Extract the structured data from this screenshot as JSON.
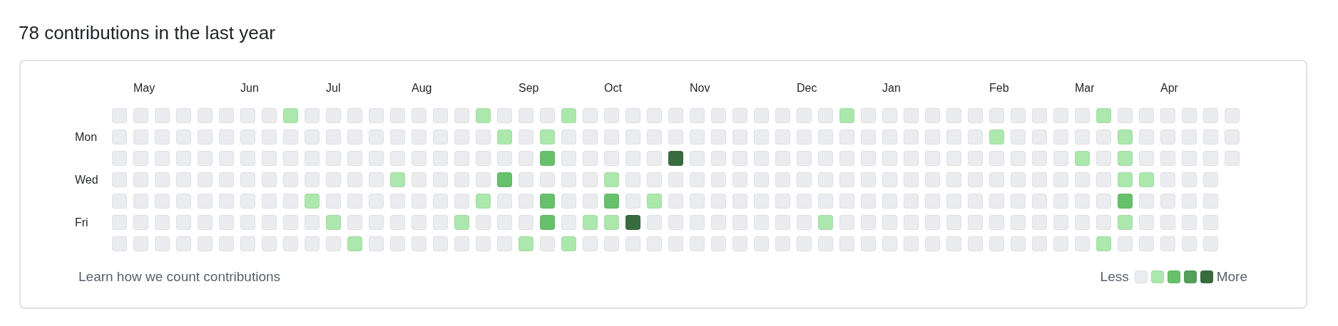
{
  "title": "78 contributions in the last year",
  "day_labels": [
    "Mon",
    "Wed",
    "Fri"
  ],
  "weeks": [
    {
      "days": [
        {
          "color": "#ebecf0"
        },
        {
          "color": "#ebecf0"
        },
        {
          "color": "#ebecf0"
        },
        {
          "color": "#ebecf0"
        },
        {
          "color": "#ebecf0"
        },
        {
          "color": "#ebecf0"
        },
        {
          "color": "#ebecf0"
        }
      ]
    },
    {
      "month": "May",
      "days": [
        {
          "color": "#ebecf0"
        },
        {
          "color": "#ebecf0"
        },
        {
          "color": "#ebecf0"
        },
        {
          "color": "#ebecf0"
        },
        {
          "color": "#ebecf0"
        },
        {
          "color": "#ebecf0"
        },
        {
          "color": "#ebecf0"
        }
      ]
    },
    {
      "days": [
        {
          "color": "#ebecf0"
        },
        {
          "color": "#ebecf0"
        },
        {
          "color": "#ebecf0"
        },
        {
          "color": "#ebecf0"
        },
        {
          "color": "#ebecf0"
        },
        {
          "color": "#ebecf0"
        },
        {
          "color": "#ebecf0"
        }
      ]
    },
    {
      "days": [
        {
          "color": "#ebecf0"
        },
        {
          "color": "#ebecf0"
        },
        {
          "color": "#ebecf0"
        },
        {
          "color": "#ebecf0"
        },
        {
          "color": "#ebecf0"
        },
        {
          "color": "#ebecf0"
        },
        {
          "color": "#ebecf0"
        }
      ]
    },
    {
      "days": [
        {
          "color": "#ebecf0"
        },
        {
          "color": "#ebecf0"
        },
        {
          "color": "#ebecf0"
        },
        {
          "color": "#ebecf0"
        },
        {
          "color": "#ebecf0"
        },
        {
          "color": "#ebecf0"
        },
        {
          "color": "#ebecf0"
        }
      ]
    },
    {
      "days": [
        {
          "color": "#ebecf0"
        },
        {
          "color": "#ebecf0"
        },
        {
          "color": "#ebecf0"
        },
        {
          "color": "#ebecf0"
        },
        {
          "color": "#ebecf0"
        },
        {
          "color": "#ebecf0"
        },
        {
          "color": "#ebecf0"
        }
      ]
    },
    {
      "month": "Jun",
      "days": [
        {
          "color": "#ebecf0"
        },
        {
          "color": "#ebecf0"
        },
        {
          "color": "#ebecf0"
        },
        {
          "color": "#ebecf0"
        },
        {
          "color": "#ebecf0"
        },
        {
          "color": "#ebecf0"
        },
        {
          "color": "#ebecf0"
        }
      ]
    },
    {
      "days": [
        {
          "color": "#ebecf0"
        },
        {
          "color": "#ebecf0"
        },
        {
          "color": "#ebecf0"
        },
        {
          "color": "#ebecf0"
        },
        {
          "color": "#ebecf0"
        },
        {
          "color": "#ebecf0"
        },
        {
          "color": "#ebecf0"
        }
      ]
    },
    {
      "days": [
        {
          "color": "#ace7ae"
        },
        {
          "color": "#ebecf0"
        },
        {
          "color": "#ebecf0"
        },
        {
          "color": "#ebecf0"
        },
        {
          "color": "#ebecf0"
        },
        {
          "color": "#ebecf0"
        },
        {
          "color": "#ebecf0"
        }
      ]
    },
    {
      "days": [
        {
          "color": "#ebecf0"
        },
        {
          "color": "#ebecf0"
        },
        {
          "color": "#ebecf0"
        },
        {
          "color": "#ebecf0"
        },
        {
          "color": "#ace7ae"
        },
        {
          "color": "#ebecf0"
        },
        {
          "color": "#ebecf0"
        }
      ]
    },
    {
      "month": "Jul",
      "days": [
        {
          "color": "#ebecf0"
        },
        {
          "color": "#ebecf0"
        },
        {
          "color": "#ebecf0"
        },
        {
          "color": "#ebecf0"
        },
        {
          "color": "#ebecf0"
        },
        {
          "color": "#ace7ae"
        },
        {
          "color": "#ebecf0"
        }
      ]
    },
    {
      "days": [
        {
          "color": "#ebecf0"
        },
        {
          "color": "#ebecf0"
        },
        {
          "color": "#ebecf0"
        },
        {
          "color": "#ebecf0"
        },
        {
          "color": "#ebecf0"
        },
        {
          "color": "#ebecf0"
        },
        {
          "color": "#ace7ae"
        }
      ]
    },
    {
      "days": [
        {
          "color": "#ebecf0"
        },
        {
          "color": "#ebecf0"
        },
        {
          "color": "#ebecf0"
        },
        {
          "color": "#ebecf0"
        },
        {
          "color": "#ebecf0"
        },
        {
          "color": "#ebecf0"
        },
        {
          "color": "#ebecf0"
        }
      ]
    },
    {
      "days": [
        {
          "color": "#ebecf0"
        },
        {
          "color": "#ebecf0"
        },
        {
          "color": "#ebecf0"
        },
        {
          "color": "#ace7ae"
        },
        {
          "color": "#ebecf0"
        },
        {
          "color": "#ebecf0"
        },
        {
          "color": "#ebecf0"
        }
      ]
    },
    {
      "month": "Aug",
      "days": [
        {
          "color": "#ebecf0"
        },
        {
          "color": "#ebecf0"
        },
        {
          "color": "#ebecf0"
        },
        {
          "color": "#ebecf0"
        },
        {
          "color": "#ebecf0"
        },
        {
          "color": "#ebecf0"
        },
        {
          "color": "#ebecf0"
        }
      ]
    },
    {
      "days": [
        {
          "color": "#ebecf0"
        },
        {
          "color": "#ebecf0"
        },
        {
          "color": "#ebecf0"
        },
        {
          "color": "#ebecf0"
        },
        {
          "color": "#ebecf0"
        },
        {
          "color": "#ebecf0"
        },
        {
          "color": "#ebecf0"
        }
      ]
    },
    {
      "days": [
        {
          "color": "#ebecf0"
        },
        {
          "color": "#ebecf0"
        },
        {
          "color": "#ebecf0"
        },
        {
          "color": "#ebecf0"
        },
        {
          "color": "#ebecf0"
        },
        {
          "color": "#ace7ae"
        },
        {
          "color": "#ebecf0"
        }
      ]
    },
    {
      "days": [
        {
          "color": "#ace7ae"
        },
        {
          "color": "#ebecf0"
        },
        {
          "color": "#ebecf0"
        },
        {
          "color": "#ebecf0"
        },
        {
          "color": "#ace7ae"
        },
        {
          "color": "#ebecf0"
        },
        {
          "color": "#ebecf0"
        }
      ]
    },
    {
      "days": [
        {
          "color": "#ebecf0"
        },
        {
          "color": "#ace7ae"
        },
        {
          "color": "#ebecf0"
        },
        {
          "color": "#66c06c"
        },
        {
          "color": "#ebecf0"
        },
        {
          "color": "#ebecf0"
        },
        {
          "color": "#ebecf0"
        }
      ]
    },
    {
      "month": "Sep",
      "days": [
        {
          "color": "#ebecf0"
        },
        {
          "color": "#ebecf0"
        },
        {
          "color": "#ebecf0"
        },
        {
          "color": "#ebecf0"
        },
        {
          "color": "#ebecf0"
        },
        {
          "color": "#ebecf0"
        },
        {
          "color": "#ace7ae"
        }
      ]
    },
    {
      "days": [
        {
          "color": "#ebecf0"
        },
        {
          "color": "#ace7ae"
        },
        {
          "color": "#66c06c"
        },
        {
          "color": "#ebecf0"
        },
        {
          "color": "#66c06c"
        },
        {
          "color": "#66c06c"
        },
        {
          "color": "#ebecf0"
        }
      ]
    },
    {
      "days": [
        {
          "color": "#ace7ae"
        },
        {
          "color": "#ebecf0"
        },
        {
          "color": "#ebecf0"
        },
        {
          "color": "#ebecf0"
        },
        {
          "color": "#ebecf0"
        },
        {
          "color": "#ebecf0"
        },
        {
          "color": "#ace7ae"
        }
      ]
    },
    {
      "days": [
        {
          "color": "#ebecf0"
        },
        {
          "color": "#ebecf0"
        },
        {
          "color": "#ebecf0"
        },
        {
          "color": "#ebecf0"
        },
        {
          "color": "#ebecf0"
        },
        {
          "color": "#ace7ae"
        },
        {
          "color": "#ebecf0"
        }
      ]
    },
    {
      "month": "Oct",
      "days": [
        {
          "color": "#ebecf0"
        },
        {
          "color": "#ebecf0"
        },
        {
          "color": "#ebecf0"
        },
        {
          "color": "#ace7ae"
        },
        {
          "color": "#66c06c"
        },
        {
          "color": "#ace7ae"
        },
        {
          "color": "#ebecf0"
        }
      ]
    },
    {
      "days": [
        {
          "color": "#ebecf0"
        },
        {
          "color": "#ebecf0"
        },
        {
          "color": "#ebecf0"
        },
        {
          "color": "#ebecf0"
        },
        {
          "color": "#ebecf0"
        },
        {
          "color": "#386c3e"
        },
        {
          "color": "#ebecf0"
        }
      ]
    },
    {
      "days": [
        {
          "color": "#ebecf0"
        },
        {
          "color": "#ebecf0"
        },
        {
          "color": "#ebecf0"
        },
        {
          "color": "#ebecf0"
        },
        {
          "color": "#ace7ae"
        },
        {
          "color": "#ebecf0"
        },
        {
          "color": "#ebecf0"
        }
      ]
    },
    {
      "days": [
        {
          "color": "#ebecf0"
        },
        {
          "color": "#ebecf0"
        },
        {
          "color": "#386c3e"
        },
        {
          "color": "#ebecf0"
        },
        {
          "color": "#ebecf0"
        },
        {
          "color": "#ebecf0"
        },
        {
          "color": "#ebecf0"
        }
      ]
    },
    {
      "month": "Nov",
      "days": [
        {
          "color": "#ebecf0"
        },
        {
          "color": "#ebecf0"
        },
        {
          "color": "#ebecf0"
        },
        {
          "color": "#ebecf0"
        },
        {
          "color": "#ebecf0"
        },
        {
          "color": "#ebecf0"
        },
        {
          "color": "#ebecf0"
        }
      ]
    },
    {
      "days": [
        {
          "color": "#ebecf0"
        },
        {
          "color": "#ebecf0"
        },
        {
          "color": "#ebecf0"
        },
        {
          "color": "#ebecf0"
        },
        {
          "color": "#ebecf0"
        },
        {
          "color": "#ebecf0"
        },
        {
          "color": "#ebecf0"
        }
      ]
    },
    {
      "days": [
        {
          "color": "#ebecf0"
        },
        {
          "color": "#ebecf0"
        },
        {
          "color": "#ebecf0"
        },
        {
          "color": "#ebecf0"
        },
        {
          "color": "#ebecf0"
        },
        {
          "color": "#ebecf0"
        },
        {
          "color": "#ebecf0"
        }
      ]
    },
    {
      "days": [
        {
          "color": "#ebecf0"
        },
        {
          "color": "#ebecf0"
        },
        {
          "color": "#ebecf0"
        },
        {
          "color": "#ebecf0"
        },
        {
          "color": "#ebecf0"
        },
        {
          "color": "#ebecf0"
        },
        {
          "color": "#ebecf0"
        }
      ]
    },
    {
      "days": [
        {
          "color": "#ebecf0"
        },
        {
          "color": "#ebecf0"
        },
        {
          "color": "#ebecf0"
        },
        {
          "color": "#ebecf0"
        },
        {
          "color": "#ebecf0"
        },
        {
          "color": "#ebecf0"
        },
        {
          "color": "#ebecf0"
        }
      ]
    },
    {
      "month": "Dec",
      "days": [
        {
          "color": "#ebecf0"
        },
        {
          "color": "#ebecf0"
        },
        {
          "color": "#ebecf0"
        },
        {
          "color": "#ebecf0"
        },
        {
          "color": "#ebecf0"
        },
        {
          "color": "#ebecf0"
        },
        {
          "color": "#ebecf0"
        }
      ]
    },
    {
      "days": [
        {
          "color": "#ebecf0"
        },
        {
          "color": "#ebecf0"
        },
        {
          "color": "#ebecf0"
        },
        {
          "color": "#ebecf0"
        },
        {
          "color": "#ebecf0"
        },
        {
          "color": "#ace7ae"
        },
        {
          "color": "#ebecf0"
        }
      ]
    },
    {
      "days": [
        {
          "color": "#ace7ae"
        },
        {
          "color": "#ebecf0"
        },
        {
          "color": "#ebecf0"
        },
        {
          "color": "#ebecf0"
        },
        {
          "color": "#ebecf0"
        },
        {
          "color": "#ebecf0"
        },
        {
          "color": "#ebecf0"
        }
      ]
    },
    {
      "days": [
        {
          "color": "#ebecf0"
        },
        {
          "color": "#ebecf0"
        },
        {
          "color": "#ebecf0"
        },
        {
          "color": "#ebecf0"
        },
        {
          "color": "#ebecf0"
        },
        {
          "color": "#ebecf0"
        },
        {
          "color": "#ebecf0"
        }
      ]
    },
    {
      "month": "Jan",
      "days": [
        {
          "color": "#ebecf0"
        },
        {
          "color": "#ebecf0"
        },
        {
          "color": "#ebecf0"
        },
        {
          "color": "#ebecf0"
        },
        {
          "color": "#ebecf0"
        },
        {
          "color": "#ebecf0"
        },
        {
          "color": "#ebecf0"
        }
      ]
    },
    {
      "days": [
        {
          "color": "#ebecf0"
        },
        {
          "color": "#ebecf0"
        },
        {
          "color": "#ebecf0"
        },
        {
          "color": "#ebecf0"
        },
        {
          "color": "#ebecf0"
        },
        {
          "color": "#ebecf0"
        },
        {
          "color": "#ebecf0"
        }
      ]
    },
    {
      "days": [
        {
          "color": "#ebecf0"
        },
        {
          "color": "#ebecf0"
        },
        {
          "color": "#ebecf0"
        },
        {
          "color": "#ebecf0"
        },
        {
          "color": "#ebecf0"
        },
        {
          "color": "#ebecf0"
        },
        {
          "color": "#ebecf0"
        }
      ]
    },
    {
      "days": [
        {
          "color": "#ebecf0"
        },
        {
          "color": "#ebecf0"
        },
        {
          "color": "#ebecf0"
        },
        {
          "color": "#ebecf0"
        },
        {
          "color": "#ebecf0"
        },
        {
          "color": "#ebecf0"
        },
        {
          "color": "#ebecf0"
        }
      ]
    },
    {
      "days": [
        {
          "color": "#ebecf0"
        },
        {
          "color": "#ebecf0"
        },
        {
          "color": "#ebecf0"
        },
        {
          "color": "#ebecf0"
        },
        {
          "color": "#ebecf0"
        },
        {
          "color": "#ebecf0"
        },
        {
          "color": "#ebecf0"
        }
      ]
    },
    {
      "month": "Feb",
      "days": [
        {
          "color": "#ebecf0"
        },
        {
          "color": "#ace7ae"
        },
        {
          "color": "#ebecf0"
        },
        {
          "color": "#ebecf0"
        },
        {
          "color": "#ebecf0"
        },
        {
          "color": "#ebecf0"
        },
        {
          "color": "#ebecf0"
        }
      ]
    },
    {
      "days": [
        {
          "color": "#ebecf0"
        },
        {
          "color": "#ebecf0"
        },
        {
          "color": "#ebecf0"
        },
        {
          "color": "#ebecf0"
        },
        {
          "color": "#ebecf0"
        },
        {
          "color": "#ebecf0"
        },
        {
          "color": "#ebecf0"
        }
      ]
    },
    {
      "days": [
        {
          "color": "#ebecf0"
        },
        {
          "color": "#ebecf0"
        },
        {
          "color": "#ebecf0"
        },
        {
          "color": "#ebecf0"
        },
        {
          "color": "#ebecf0"
        },
        {
          "color": "#ebecf0"
        },
        {
          "color": "#ebecf0"
        }
      ]
    },
    {
      "days": [
        {
          "color": "#ebecf0"
        },
        {
          "color": "#ebecf0"
        },
        {
          "color": "#ebecf0"
        },
        {
          "color": "#ebecf0"
        },
        {
          "color": "#ebecf0"
        },
        {
          "color": "#ebecf0"
        },
        {
          "color": "#ebecf0"
        }
      ]
    },
    {
      "month": "Mar",
      "days": [
        {
          "color": "#ebecf0"
        },
        {
          "color": "#ebecf0"
        },
        {
          "color": "#ace7ae"
        },
        {
          "color": "#ebecf0"
        },
        {
          "color": "#ebecf0"
        },
        {
          "color": "#ebecf0"
        },
        {
          "color": "#ebecf0"
        }
      ]
    },
    {
      "days": [
        {
          "color": "#ace7ae"
        },
        {
          "color": "#ebecf0"
        },
        {
          "color": "#ebecf0"
        },
        {
          "color": "#ebecf0"
        },
        {
          "color": "#ebecf0"
        },
        {
          "color": "#ebecf0"
        },
        {
          "color": "#ace7ae"
        }
      ]
    },
    {
      "days": [
        {
          "color": "#ebecf0"
        },
        {
          "color": "#ace7ae"
        },
        {
          "color": "#ace7ae"
        },
        {
          "color": "#ace7ae"
        },
        {
          "color": "#66c06c"
        },
        {
          "color": "#ace7ae"
        },
        {
          "color": "#ebecf0"
        }
      ]
    },
    {
      "days": [
        {
          "color": "#ebecf0"
        },
        {
          "color": "#ebecf0"
        },
        {
          "color": "#ebecf0"
        },
        {
          "color": "#ace7ae"
        },
        {
          "color": "#ebecf0"
        },
        {
          "color": "#ebecf0"
        },
        {
          "color": "#ebecf0"
        }
      ]
    },
    {
      "month": "Apr",
      "days": [
        {
          "color": "#ebecf0"
        },
        {
          "color": "#ebecf0"
        },
        {
          "color": "#ebecf0"
        },
        {
          "color": "#ebecf0"
        },
        {
          "color": "#ebecf0"
        },
        {
          "color": "#ebecf0"
        },
        {
          "color": "#ebecf0"
        }
      ]
    },
    {
      "days": [
        {
          "color": "#ebecf0"
        },
        {
          "color": "#ebecf0"
        },
        {
          "color": "#ebecf0"
        },
        {
          "color": "#ebecf0"
        },
        {
          "color": "#ebecf0"
        },
        {
          "color": "#ebecf0"
        },
        {
          "color": "#ebecf0"
        }
      ]
    },
    {
      "days": [
        {
          "color": "#ebecf0"
        },
        {
          "color": "#ebecf0"
        },
        {
          "color": "#ebecf0"
        },
        {
          "color": "#ebecf0"
        },
        {
          "color": "#ebecf0"
        },
        {
          "color": "#ebecf0"
        },
        {
          "color": "#ebecf0"
        }
      ]
    },
    {
      "days": [
        {
          "color": "#ebecf0"
        },
        {
          "color": "#ebecf0"
        },
        {
          "color": "#ebecf0"
        }
      ]
    }
  ],
  "footer_link": "Learn how we count contributions",
  "legend": {
    "less": "Less",
    "more": "More",
    "swatches": [
      {
        "color": "#ebecf0"
      },
      {
        "color": "#ace7ae"
      },
      {
        "color": "#66c06c"
      },
      {
        "color": "#549f5a"
      },
      {
        "color": "#386c3e"
      }
    ]
  }
}
